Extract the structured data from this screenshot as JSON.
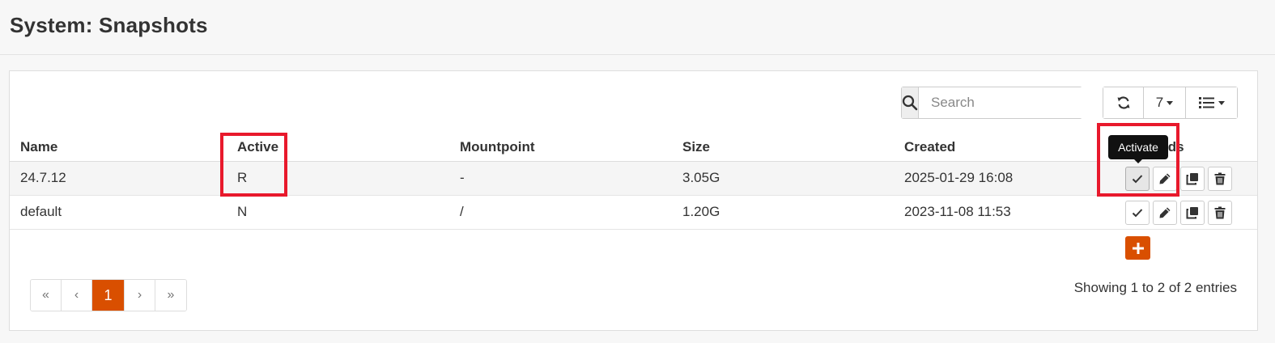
{
  "page": {
    "title": "System: Snapshots"
  },
  "toolbar": {
    "search_placeholder": "Search",
    "rows_per_page": "7"
  },
  "table": {
    "columns": {
      "name": "Name",
      "active": "Active",
      "mountpoint": "Mountpoint",
      "size": "Size",
      "created": "Created",
      "commands": "Commands"
    },
    "rows": [
      {
        "name": "24.7.12",
        "active": "R",
        "mountpoint": "-",
        "size": "3.05G",
        "created": "2025-01-29 16:08"
      },
      {
        "name": "default",
        "active": "N",
        "mountpoint": "/",
        "size": "1.20G",
        "created": "2023-11-08 11:53"
      }
    ]
  },
  "tooltip": {
    "text": "Activate"
  },
  "pagination": {
    "first": "«",
    "prev": "‹",
    "current": "1",
    "next": "›",
    "last": "»"
  },
  "footer": {
    "entries": "Showing 1 to 2 of 2 entries"
  },
  "colors": {
    "accent": "#d94f00",
    "highlight": "#e8192c"
  }
}
